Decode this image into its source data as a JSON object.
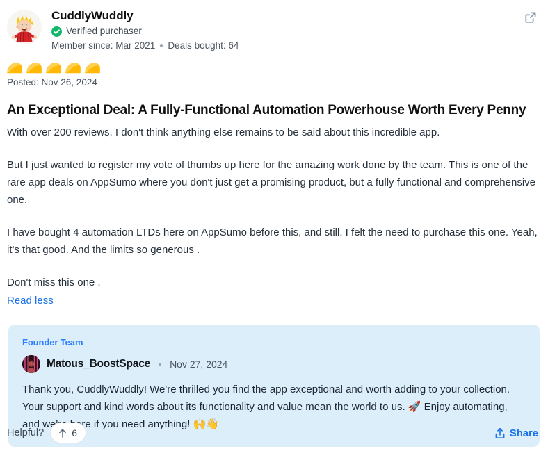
{
  "review": {
    "author": {
      "name": "CuddlyWuddly",
      "verified_label": "Verified purchaser",
      "member_since": "Member since: Mar 2021",
      "deals_bought": "Deals bought: 64"
    },
    "rating": {
      "value": 5,
      "max": 5,
      "icon": "taco-icon",
      "filled_color": "#ffb803",
      "shell_color": "#ffcd3c"
    },
    "posted": "Posted: Nov 26, 2024",
    "title": "An Exceptional Deal: A Fully-Functional Automation Powerhouse Worth Every Penny",
    "paragraphs": [
      "With over 200 reviews, I don't think anything else remains to be said about this incredible app.",
      "But I just wanted to register my vote of thumbs up here for the amazing work done by the team. This is one of the rare app deals on AppSumo where you don't just get a promising product, but a fully functional and comprehensive one.",
      "I have bought 4 automation LTDs here on AppSumo before this, and still, I felt the need to purchase this one. Yeah, it's that good. And the limits so generous .",
      "Don't miss this one ."
    ],
    "read_toggle_label": "Read less",
    "external_link_icon": "external-link-icon"
  },
  "founder_reply": {
    "badge_label": "Founder Team",
    "name": "Matous_BoostSpace",
    "date": "Nov 27, 2024",
    "text_part1": "Thank you, CuddlyWuddly! We're thrilled you find the app exceptional and worth adding to your collection. Your support and kind words about its functionality and value mean the world to us. ",
    "emoji_rocket": "🚀",
    "text_part2": " Enjoy automating, and we're here if you need anything! ",
    "emoji_hands": "🙌",
    "emoji_wave": "👋",
    "background_color": "#ddeefb",
    "badge_color": "#2b7fff"
  },
  "footer": {
    "helpful_label": "Helpful?",
    "upvote_count": "6",
    "upvote_icon": "arrow-up-icon",
    "share_label": "Share",
    "share_icon": "share-icon",
    "link_color": "#1a73e8"
  }
}
